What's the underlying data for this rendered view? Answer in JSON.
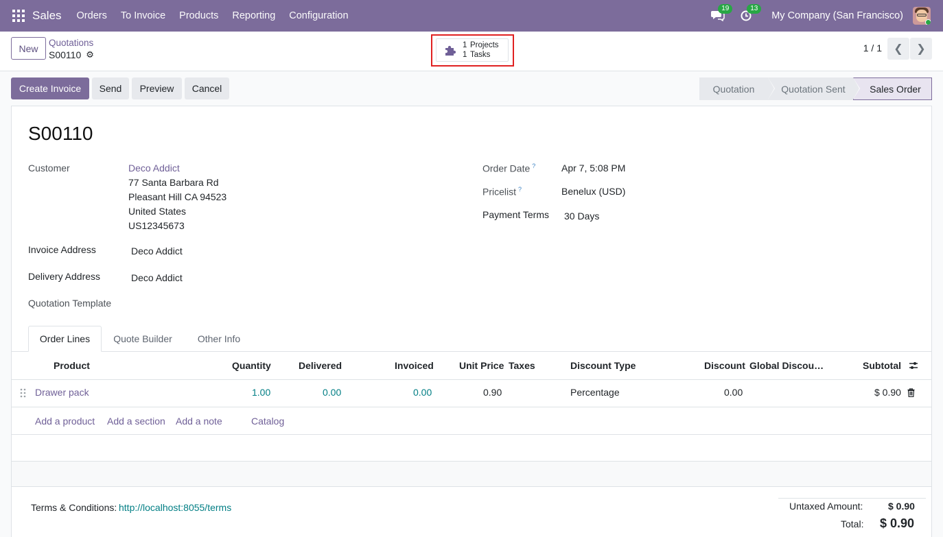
{
  "navbar": {
    "app_name": "Sales",
    "menu": [
      "Orders",
      "To Invoice",
      "Products",
      "Reporting",
      "Configuration"
    ],
    "messages_count": "19",
    "activities_count": "13",
    "company": "My Company (San Francisco)"
  },
  "control": {
    "new_label": "New",
    "breadcrumb_parent": "Quotations",
    "breadcrumb_current": "S00110",
    "smart_button": {
      "projects_count": "1",
      "projects_label": "Projects",
      "tasks_count": "1",
      "tasks_label": "Tasks"
    },
    "pager": "1 / 1"
  },
  "actions": {
    "create_invoice": "Create Invoice",
    "send": "Send",
    "preview": "Preview",
    "cancel": "Cancel"
  },
  "status": {
    "stages": [
      "Quotation",
      "Quotation Sent",
      "Sales Order"
    ],
    "active": "Sales Order"
  },
  "form": {
    "name": "S00110",
    "customer_label": "Customer",
    "customer_name": "Deco Addict",
    "customer_address": [
      "77 Santa Barbara Rd",
      "Pleasant Hill CA 94523",
      "United States",
      "US12345673"
    ],
    "invoice_address_label": "Invoice Address",
    "invoice_address": "Deco Addict",
    "delivery_address_label": "Delivery Address",
    "delivery_address": "Deco Addict",
    "quotation_template_label": "Quotation Template",
    "order_date_label": "Order Date",
    "order_date": "Apr 7, 5:08 PM",
    "pricelist_label": "Pricelist",
    "pricelist": "Benelux (USD)",
    "payment_terms_label": "Payment Terms",
    "payment_terms": "30 Days",
    "help_mark": "?"
  },
  "tabs": [
    "Order Lines",
    "Quote Builder",
    "Other Info"
  ],
  "table": {
    "columns": [
      "Product",
      "Quantity",
      "Delivered",
      "Invoiced",
      "Unit Price",
      "Taxes",
      "Discount Type",
      "Discount",
      "Global Discou…",
      "Subtotal"
    ],
    "rows": [
      {
        "product": "Drawer pack",
        "quantity": "1.00",
        "delivered": "0.00",
        "invoiced": "0.00",
        "unit_price": "0.90",
        "taxes": "",
        "discount_type": "Percentage",
        "discount": "0.00",
        "global_discount": "",
        "subtotal": "$ 0.90"
      }
    ],
    "add_links": [
      "Add a product",
      "Add a section",
      "Add a note",
      "Catalog"
    ]
  },
  "footer": {
    "terms_label": "Terms & Conditions:",
    "terms_link": "http://localhost:8055/terms",
    "untaxed_label": "Untaxed Amount:",
    "untaxed_value": "$ 0.90",
    "total_label": "Total:",
    "total_value": "$ 0.90"
  },
  "colors": {
    "brand": "#7c6c9b",
    "link": "#6f5f97",
    "teal": "#017e84",
    "badge": "#28a745",
    "highlight": "#e02020"
  }
}
